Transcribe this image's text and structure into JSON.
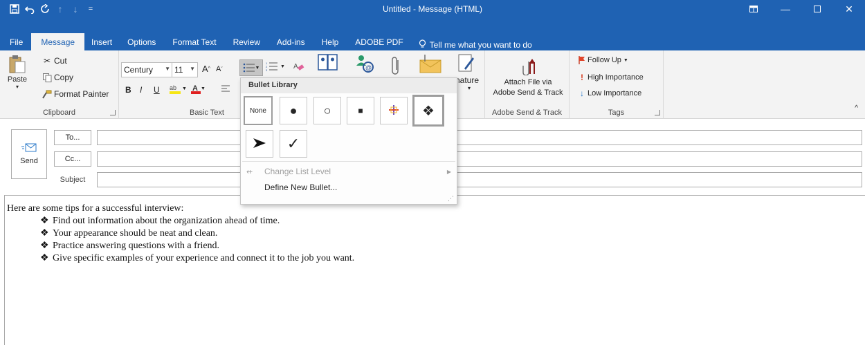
{
  "window": {
    "title": "Untitled - Message (HTML)"
  },
  "qat": {
    "save": "save-icon",
    "undo": "undo-icon",
    "redo": "redo-icon"
  },
  "tabs": [
    "File",
    "Message",
    "Insert",
    "Options",
    "Format Text",
    "Review",
    "Add-ins",
    "Help",
    "ADOBE PDF"
  ],
  "active_tab": "Message",
  "tell_me": "Tell me what you want to do",
  "ribbon": {
    "clipboard": {
      "label": "Clipboard",
      "paste": "Paste",
      "cut": "Cut",
      "copy": "Copy",
      "format_painter": "Format Painter"
    },
    "basic_text": {
      "label": "Basic Text",
      "font": "Century",
      "size": "11",
      "bold": "B",
      "italic": "I",
      "underline": "U"
    },
    "signature_partial": "nature",
    "adobe": {
      "label": "Adobe Send & Track",
      "attach_line1": "Attach File via",
      "attach_line2": "Adobe Send & Track"
    },
    "tags": {
      "label": "Tags",
      "follow_up": "Follow Up",
      "high": "High Importance",
      "low": "Low Importance"
    }
  },
  "bullet_menu": {
    "header": "Bullet Library",
    "none": "None",
    "change_level": "Change List Level",
    "define_new": "Define New Bullet..."
  },
  "compose": {
    "send": "Send",
    "to": "To...",
    "cc": "Cc...",
    "subject": "Subject"
  },
  "body": {
    "intro": "Here are some tips for a successful interview:",
    "bullet_char": "❖",
    "items": [
      "Find out information about the organization ahead of time.",
      "Your appearance should be neat and clean.",
      "Practice answering questions with a friend.",
      "Give specific examples of your experience and connect it to the job you want."
    ]
  }
}
